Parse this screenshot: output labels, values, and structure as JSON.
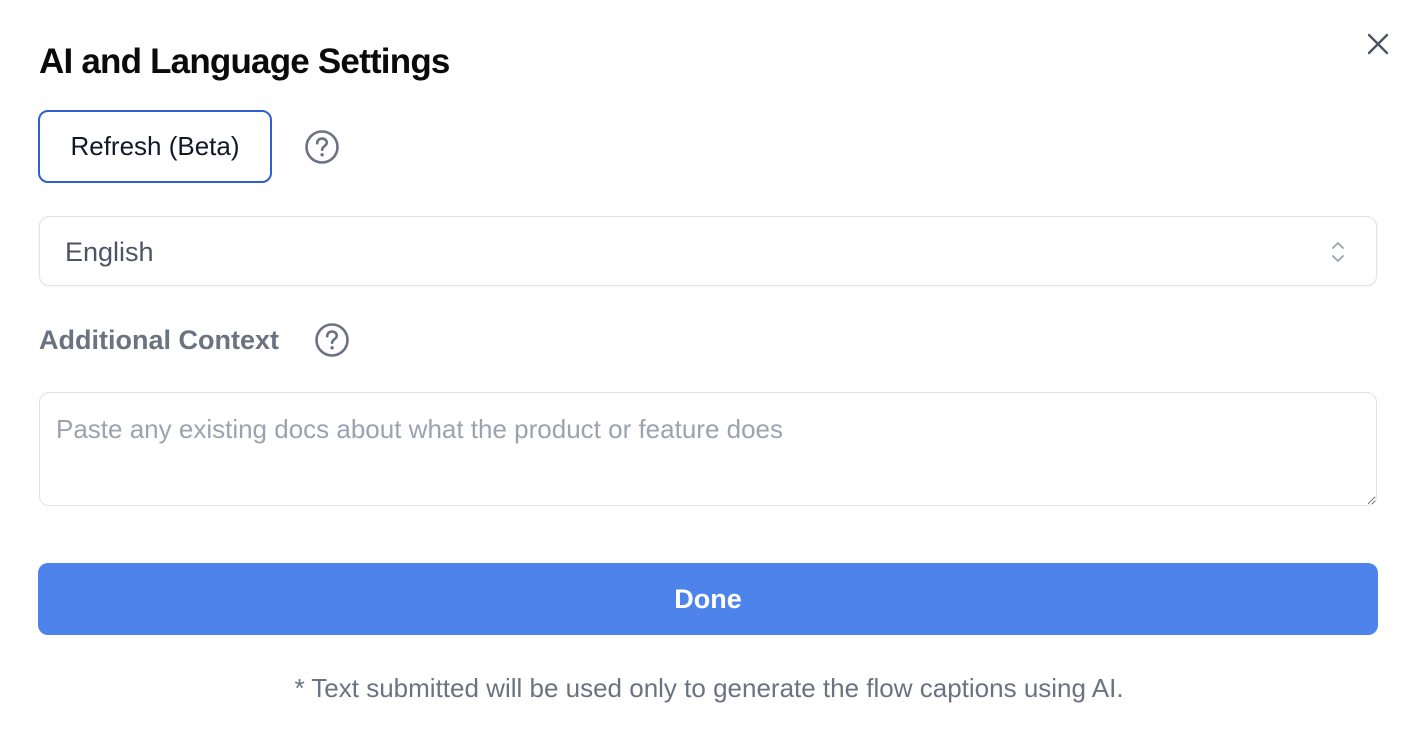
{
  "dialog": {
    "title": "AI and Language Settings"
  },
  "refresh": {
    "label": "Refresh (Beta)"
  },
  "language": {
    "selected": "English"
  },
  "context": {
    "label": "Additional Context",
    "placeholder": "Paste any existing docs about what the product or feature does",
    "value": ""
  },
  "actions": {
    "done_label": "Done"
  },
  "disclaimer": "* Text submitted will be used only to generate the flow captions using AI.",
  "colors": {
    "primary": "#4f83ec",
    "focus_border": "#2f5fd0",
    "muted_text": "#6b7280",
    "placeholder": "#9ca3af"
  },
  "icons": {
    "close": "close-icon",
    "help": "help-circle-icon",
    "select": "chevron-up-down-icon",
    "resize": "resize-handle-icon"
  }
}
